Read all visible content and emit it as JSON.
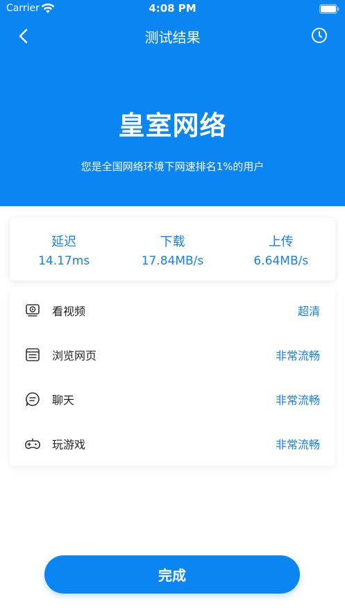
{
  "status_bar": {
    "carrier": "Carrier",
    "time": "4:08 PM"
  },
  "nav": {
    "title": "测试结果",
    "back_icon": "chevron-left-icon",
    "history_icon": "clock-icon"
  },
  "result": {
    "quality": "皇室网络",
    "subtitle": "您是全国网络环境下网速排名1%的用户"
  },
  "stats": [
    {
      "label": "延迟",
      "value": "14.17ms"
    },
    {
      "label": "下载",
      "value": "17.84MB/s"
    },
    {
      "label": "上传",
      "value": "6.64MB/s"
    }
  ],
  "activities": [
    {
      "icon": "video-icon",
      "label": "看视频",
      "value": "超清"
    },
    {
      "icon": "browser-icon",
      "label": "浏览网页",
      "value": "非常流畅"
    },
    {
      "icon": "chat-icon",
      "label": "聊天",
      "value": "非常流畅"
    },
    {
      "icon": "gamepad-icon",
      "label": "玩游戏",
      "value": "非常流畅"
    }
  ],
  "done_button": "完成",
  "colors": {
    "primary": "#0a85f2",
    "accent_text": "#1780e6"
  }
}
